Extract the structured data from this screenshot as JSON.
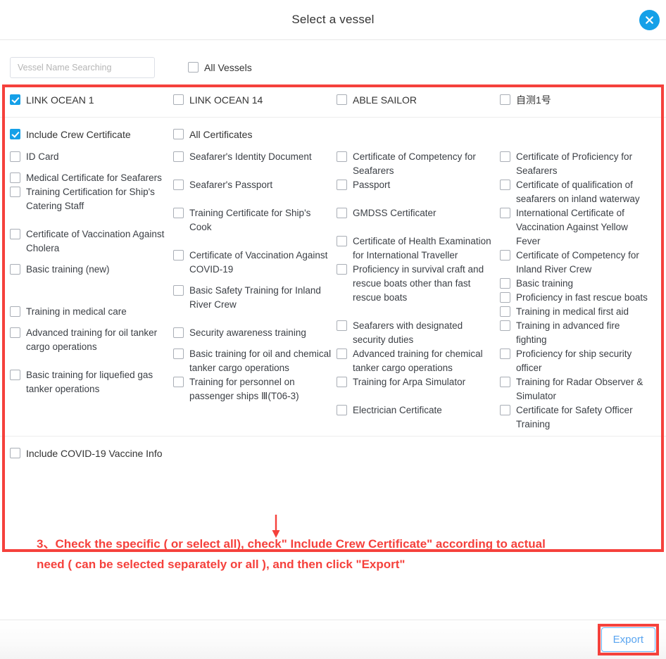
{
  "header": {
    "title": "Select a vessel",
    "close_icon": "close-icon"
  },
  "vessel_section": {
    "search": {
      "placeholder": "Vessel Name Searching",
      "value": ""
    },
    "all_vessels": {
      "label": "All Vessels",
      "checked": false
    },
    "vessels": [
      {
        "label": "LINK OCEAN 1",
        "checked": true
      },
      {
        "label": "LINK OCEAN 14",
        "checked": false
      },
      {
        "label": "ABLE SAILOR",
        "checked": false
      },
      {
        "label": "自测1号",
        "checked": false
      }
    ]
  },
  "certificate_section": {
    "include_crew_certificate": {
      "label": "Include Crew Certificate",
      "checked": true
    },
    "all_certificates": {
      "label": "All Certificates",
      "checked": false
    },
    "columns": [
      {
        "items": [
          {
            "label": "ID Card",
            "checked": false
          },
          {
            "label": "Medical Certificate for Seafarers",
            "checked": false,
            "gap_before": 10
          },
          {
            "label": "Training Certification for Ship's Catering Staff",
            "checked": false
          },
          {
            "label": "Certificate of Vaccination Against Cholera",
            "checked": false,
            "gap_before": 20
          },
          {
            "label": "Basic training (new)",
            "checked": false,
            "gap_before": 10
          },
          {
            "label": "Training in medical care",
            "checked": false,
            "gap_before": 40
          },
          {
            "label": "Advanced training for oil tanker cargo operations",
            "checked": false,
            "gap_before": 10
          },
          {
            "label": "Basic training for liquefied gas tanker operations",
            "checked": false,
            "gap_before": 20
          }
        ]
      },
      {
        "items": [
          {
            "label": "Seafarer's Identity Document",
            "checked": false
          },
          {
            "label": "Seafarer's Passport",
            "checked": false,
            "gap_before": 20
          },
          {
            "label": "Training Certificate for Ship's Cook",
            "checked": false,
            "gap_before": 20
          },
          {
            "label": "Certificate of Vaccination Against COVID-19",
            "checked": false,
            "gap_before": 20
          },
          {
            "label": "Basic Safety Training for Inland River Crew",
            "checked": false,
            "gap_before": 10
          },
          {
            "label": "Security awareness training",
            "checked": false,
            "gap_before": 20
          },
          {
            "label": "Basic training for oil and chemical tanker cargo operations",
            "checked": false,
            "gap_before": 10
          },
          {
            "label": "Training for personnel on passenger ships Ⅲ(T06-3)",
            "checked": false
          }
        ]
      },
      {
        "items": [
          {
            "label": "Certificate of Competency for Seafarers",
            "checked": false
          },
          {
            "label": "Passport",
            "checked": false
          },
          {
            "label": "GMDSS Certificater",
            "checked": false,
            "gap_before": 20
          },
          {
            "label": "Certificate of Health Examination for International Traveller",
            "checked": false,
            "gap_before": 20
          },
          {
            "label": "Proficiency in survival craft and rescue boats other than fast rescue boats",
            "checked": false
          },
          {
            "label": "Seafarers with designated security duties",
            "checked": false,
            "gap_before": 20
          },
          {
            "label": "Advanced training for chemical tanker cargo operations",
            "checked": false
          },
          {
            "label": "Training for Arpa Simulator",
            "checked": false
          },
          {
            "label": "Electrician Certificate",
            "checked": false,
            "gap_before": 20
          }
        ]
      },
      {
        "items": [
          {
            "label": "Certificate of Proficiency for Seafarers",
            "checked": false
          },
          {
            "label": "Certificate of qualification of seafarers on inland waterway",
            "checked": false
          },
          {
            "label": "International Certificate of Vaccination Against Yellow Fever",
            "checked": false
          },
          {
            "label": "Certificate of Competency for Inland River Crew",
            "checked": false
          },
          {
            "label": "Basic training",
            "checked": false
          },
          {
            "label": "Proficiency in fast rescue boats",
            "checked": false
          },
          {
            "label": "Training in medical first aid",
            "checked": false
          },
          {
            "label": "Training in advanced fire fighting",
            "checked": false
          },
          {
            "label": "Proficiency for ship security officer",
            "checked": false
          },
          {
            "label": "Training for Radar Observer & Simulator",
            "checked": false
          },
          {
            "label": "Certificate for Safety Officer Training",
            "checked": false
          }
        ]
      }
    ]
  },
  "covid_section": {
    "include_covid_vaccine_info": {
      "label": "Include COVID-19 Vaccine Info",
      "checked": false
    }
  },
  "annotation": {
    "line1": "3、Check the specific ( or select all), check\" Include Crew Certificate\" according to actual",
    "line2": "need ( can be selected separately or all ), and then click \"Export\"",
    "color": "#f5413c",
    "arrow_icon": "down-arrow-icon"
  },
  "footer": {
    "export_label": "Export"
  },
  "colors": {
    "accent_blue": "#15a0e8",
    "annotation_red": "#f5413c",
    "button_blue": "#66b1ff",
    "text": "#3b3f45"
  }
}
